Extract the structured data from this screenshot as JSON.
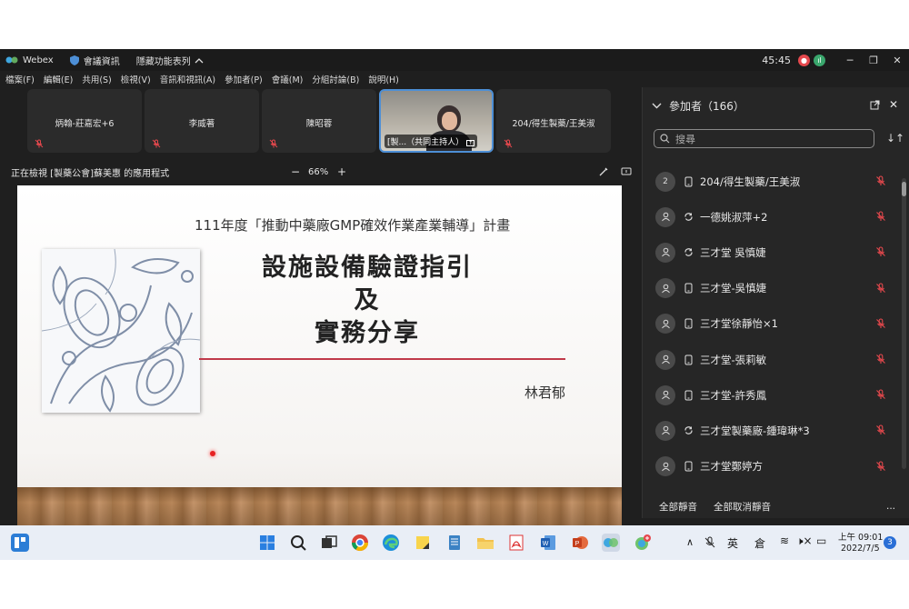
{
  "window": {
    "app_name": "Webex",
    "meeting_info": "會議資訊",
    "hide_menu": "隱藏功能表列",
    "timer": "45:45"
  },
  "menu": [
    "檔案(F)",
    "編輯(E)",
    "共用(S)",
    "檢視(V)",
    "音訊和視訊(A)",
    "參加者(P)",
    "會議(M)",
    "分組討論(B)",
    "說明(H)"
  ],
  "strip": {
    "tiles": [
      {
        "name": "炳翰-莊嘉宏+6"
      },
      {
        "name": "李威著"
      },
      {
        "name": "陳昭蓉"
      },
      {
        "name": "[製...（共同主持人）"
      },
      {
        "name": "204/得生製藥/王美淑"
      }
    ]
  },
  "viewbar": {
    "viewing_text": "正在檢視 [製藥公會]蘇美惠 的應用程式",
    "zoom_minus": "−",
    "zoom_level": "66%",
    "zoom_plus": "+"
  },
  "slide": {
    "subtitle": "111年度「推動中藥廠GMP確效作業產業輔導」計畫",
    "title_line1": "設施設備驗證指引",
    "title_line2": "及",
    "title_line3": "實務分享",
    "author": "林君郁"
  },
  "panel": {
    "title": "參加者（166）",
    "search_placeholder": "搜尋",
    "participants": [
      {
        "avatar": "2",
        "device": "phone",
        "name": "204/得生製藥/王美淑"
      },
      {
        "avatar": "user",
        "device": "sync",
        "name": "一德姚淑萍+2"
      },
      {
        "avatar": "user",
        "device": "sync",
        "name": "三才堂 吳慎婕"
      },
      {
        "avatar": "user",
        "device": "phone",
        "name": "三才堂-吳慎婕"
      },
      {
        "avatar": "user",
        "device": "phone",
        "name": "三才堂徐靜怡×1"
      },
      {
        "avatar": "user",
        "device": "phone",
        "name": "三才堂-張莉敏"
      },
      {
        "avatar": "user",
        "device": "phone",
        "name": "三才堂-許秀鳳"
      },
      {
        "avatar": "user",
        "device": "sync",
        "name": "三才堂製藥廠-鍾瑋琳*3"
      },
      {
        "avatar": "user",
        "device": "phone",
        "name": "三才堂鄭婷方"
      }
    ],
    "mute_all": "全部靜音",
    "unmute_all": "全部取消靜音",
    "more": "..."
  },
  "taskbar": {
    "ime_lang": "英",
    "ime_mode": "倉",
    "time": "上午 09:01",
    "date": "2022/7/5",
    "notifications": "3"
  },
  "colors": {
    "mute_red": "#e5484d",
    "accent_blue": "#4d8fd6",
    "slide_line": "#c0394a"
  }
}
